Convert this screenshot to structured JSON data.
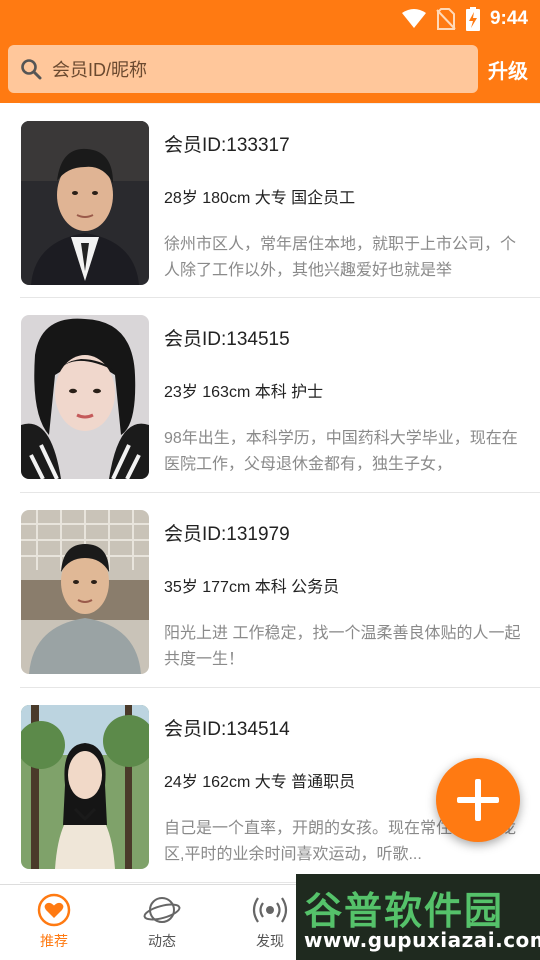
{
  "status_bar": {
    "time": "9:44"
  },
  "search": {
    "placeholder": "会员ID/昵称",
    "upgrade_label": "升级"
  },
  "members": [
    {
      "id_label": "会员ID:133317",
      "meta": "28岁 180cm 大专 国企员工",
      "intro": "徐州市区人，常年居住本地，就职于上市公司，个人除了工作以外，其他兴趣爱好也就是举"
    },
    {
      "id_label": "会员ID:134515",
      "meta": "23岁 163cm 本科 护士",
      "intro": "98年出生，本科学历，中国药科大学毕业，现在在医院工作，父母退休金都有，独生子女，"
    },
    {
      "id_label": "会员ID:131979",
      "meta": "35岁 177cm 本科 公务员",
      "intro": "阳光上进 工作稳定，找一个温柔善良体贴的人一起共度一生！"
    },
    {
      "id_label": "会员ID:134514",
      "meta": "24岁 162cm 大专 普通职员",
      "intro": "自己是一个直率，开朗的女孩。现在常住徐州云龙区,平时的业余时间喜欢运动，听歌..."
    }
  ],
  "nav": {
    "recommend": "推荐",
    "moments": "动态",
    "discover": "发现"
  },
  "watermark": {
    "title": "谷普软件园",
    "url": "www.gupuxiazai.com"
  },
  "colors": {
    "accent": "#ff7a12",
    "search_bg": "#ffc79b"
  }
}
